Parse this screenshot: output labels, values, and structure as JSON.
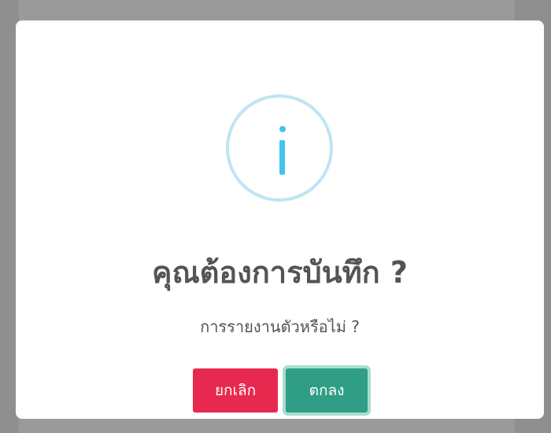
{
  "dialog": {
    "icon": "info-icon",
    "title": "คุณต้องการบันทึก ?",
    "message": "การรายงานตัวหรือไม่ ?",
    "cancel_label": "ยกเลิก",
    "confirm_label": "ตกลง"
  },
  "colors": {
    "overlay": "#8f8f8f",
    "icon_accent": "#46c3ec",
    "icon_ring": "#bfe5f4",
    "cancel_button": "#e8294f",
    "confirm_button": "#2f9e84",
    "text": "#545454"
  }
}
